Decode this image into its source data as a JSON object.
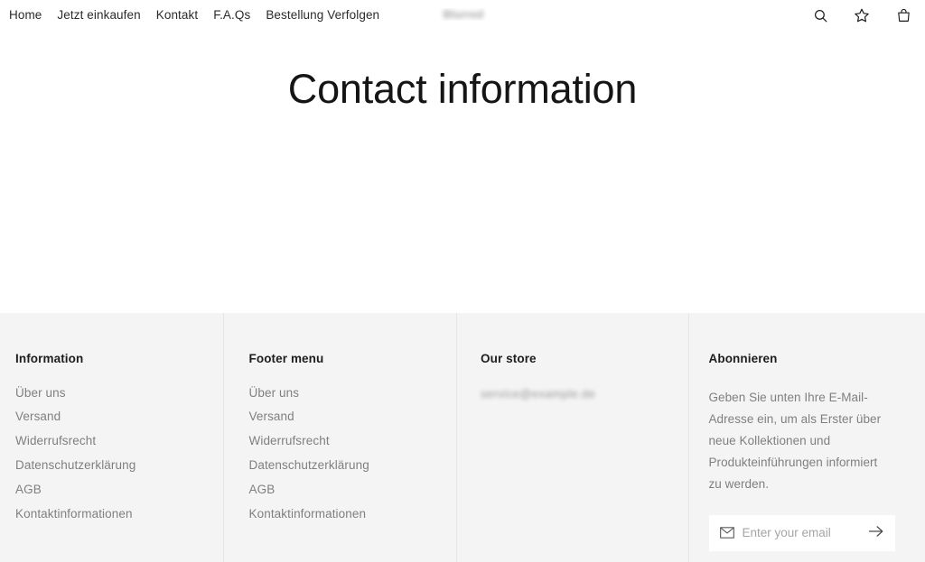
{
  "header": {
    "nav_items": [
      {
        "label": "Home",
        "name": "home"
      },
      {
        "label": "Jetzt einkaufen",
        "name": "shop-now"
      },
      {
        "label": "Kontakt",
        "name": "kontakt"
      },
      {
        "label": "F.A.Qs",
        "name": "faqs"
      },
      {
        "label": "Bestellung Verfolgen",
        "name": "track-order"
      }
    ],
    "logo_text": "Blurred",
    "icons": [
      {
        "name": "search-icon",
        "label": "Search"
      },
      {
        "name": "wishlist-star-icon",
        "label": "Wishlist"
      },
      {
        "name": "shopping-bag-icon",
        "label": "Cart"
      }
    ]
  },
  "main": {
    "title": "Contact information"
  },
  "footer": {
    "background_color": "#f5f4f4",
    "columns": [
      {
        "heading": "Information",
        "links": [
          "Über uns",
          "Versand",
          "Widerrufsrecht",
          "Datenschutzerklärung",
          "AGB",
          "Kontaktinformationen"
        ]
      },
      {
        "heading": "Footer menu",
        "links": [
          "Über uns",
          "Versand",
          "Widerrufsrecht",
          "Datenschutzerklärung",
          "AGB",
          "Kontaktinformationen"
        ]
      }
    ],
    "store": {
      "heading": "Our store",
      "address": "service@example.de"
    },
    "newsletter": {
      "heading": "Abonnieren",
      "description": "Geben Sie unten Ihre E-Mail-Adresse ein, um als Erster über neue Kollektionen und Produkteinführungen informiert zu werden.",
      "placeholder": "Enter your email",
      "value": "",
      "mail_icon": "envelope-icon",
      "submit_icon": "arrow-right-icon"
    }
  }
}
